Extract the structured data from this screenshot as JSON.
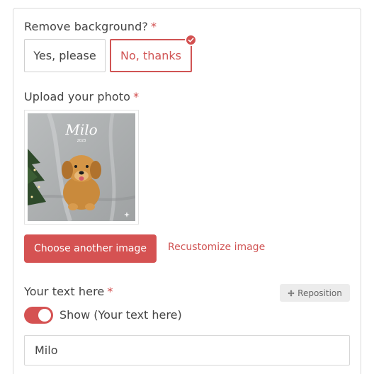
{
  "remove_background": {
    "label": "Remove background?",
    "required_mark": "*",
    "options": [
      {
        "label": "Yes, please",
        "selected": false
      },
      {
        "label": "No, thanks",
        "selected": true
      }
    ],
    "selected_icon": "check-circle-icon"
  },
  "upload": {
    "label": "Upload your photo",
    "required_mark": "*",
    "image_overlay_title": "Milo",
    "image_overlay_year": "2023",
    "choose_button": "Choose another image",
    "recustomize_link": "Recustomize image"
  },
  "text_field": {
    "label": "Your text here",
    "required_mark": "*",
    "reposition_label": "Reposition",
    "reposition_icon": "move-icon",
    "toggle_on": true,
    "toggle_label": "Show (Your text here)",
    "value": "Milo"
  },
  "colors": {
    "accent": "#d55252",
    "border": "#d9d9d9"
  }
}
